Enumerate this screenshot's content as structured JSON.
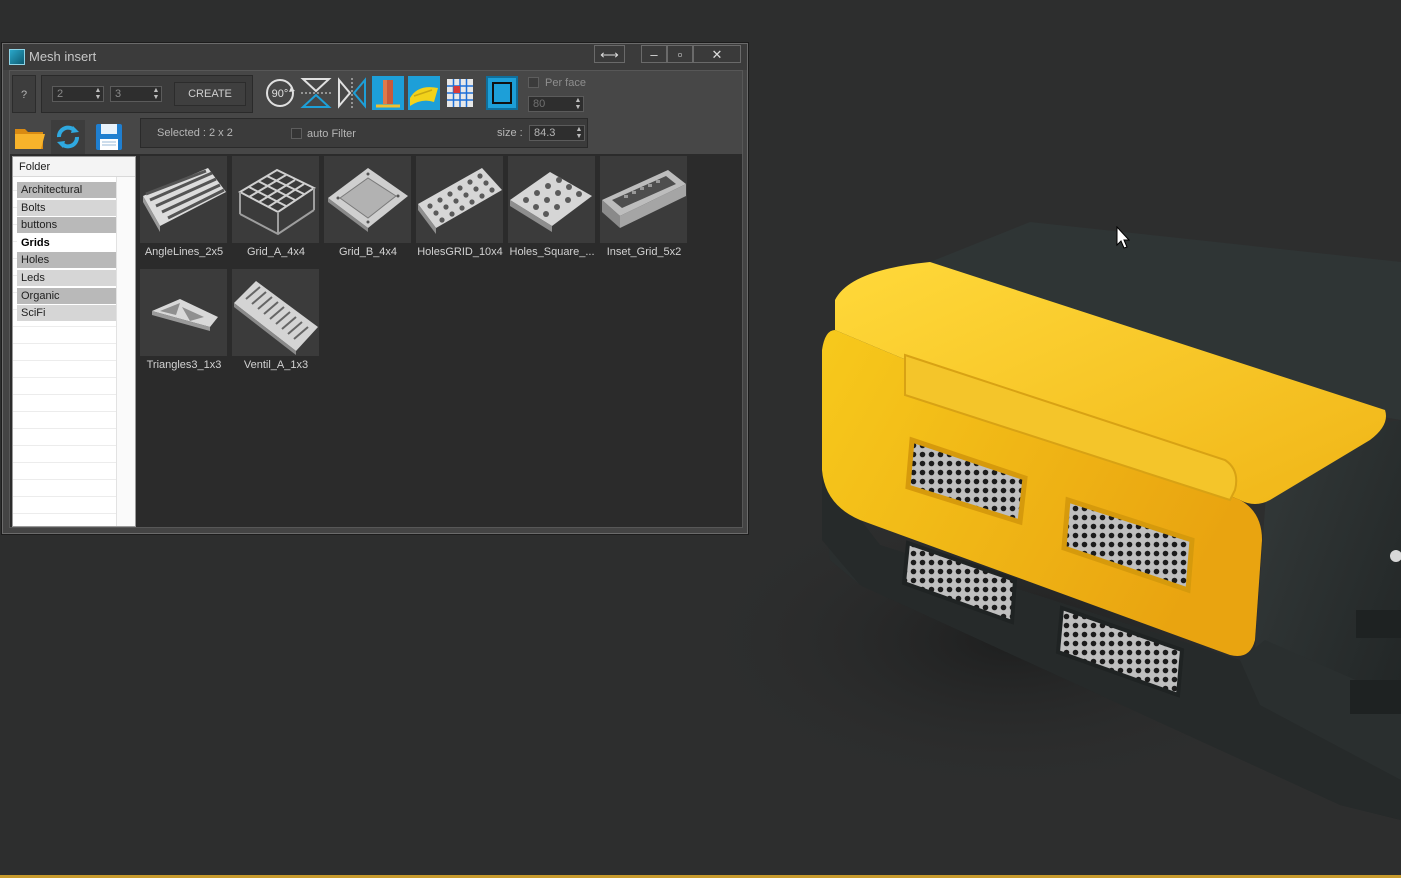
{
  "window": {
    "title": "Mesh insert",
    "help_label": "?",
    "rows_value": "2",
    "cols_value": "3",
    "create_label": "CREATE",
    "per_face_label": "Per face",
    "per_face_value": "80",
    "selected_text": "Selected : 2 x 2",
    "auto_filter_label": "auto Filter",
    "size_label": "size :",
    "size_value": "84.3",
    "rotate_label": "90°"
  },
  "folders": {
    "header": "Folder",
    "items": [
      "Architectural",
      "Bolts",
      "buttons",
      "Grids",
      "Holes",
      "Leds",
      "Organic",
      "SciFi"
    ],
    "selected": "Grids"
  },
  "thumbnails": [
    {
      "label": "AngleLines_2x5",
      "icon": "angle-lines-icon"
    },
    {
      "label": "Grid_A_4x4",
      "icon": "grid-a-icon"
    },
    {
      "label": "Grid_B_4x4",
      "icon": "grid-b-icon"
    },
    {
      "label": "HolesGRID_10x4",
      "icon": "holes-grid-icon"
    },
    {
      "label": "Holes_Square_...",
      "icon": "holes-square-icon"
    },
    {
      "label": "Inset_Grid_5x2",
      "icon": "inset-grid-icon"
    },
    {
      "label": "Triangles3_1x3",
      "icon": "triangles-icon"
    },
    {
      "label": "Ventil_A_1x3",
      "icon": "ventil-icon"
    }
  ],
  "colors": {
    "accent_blue": "#1d9fd8",
    "model_yellow": "#f2c418",
    "model_dark": "#2e3333",
    "background": "#2d2e2e"
  }
}
